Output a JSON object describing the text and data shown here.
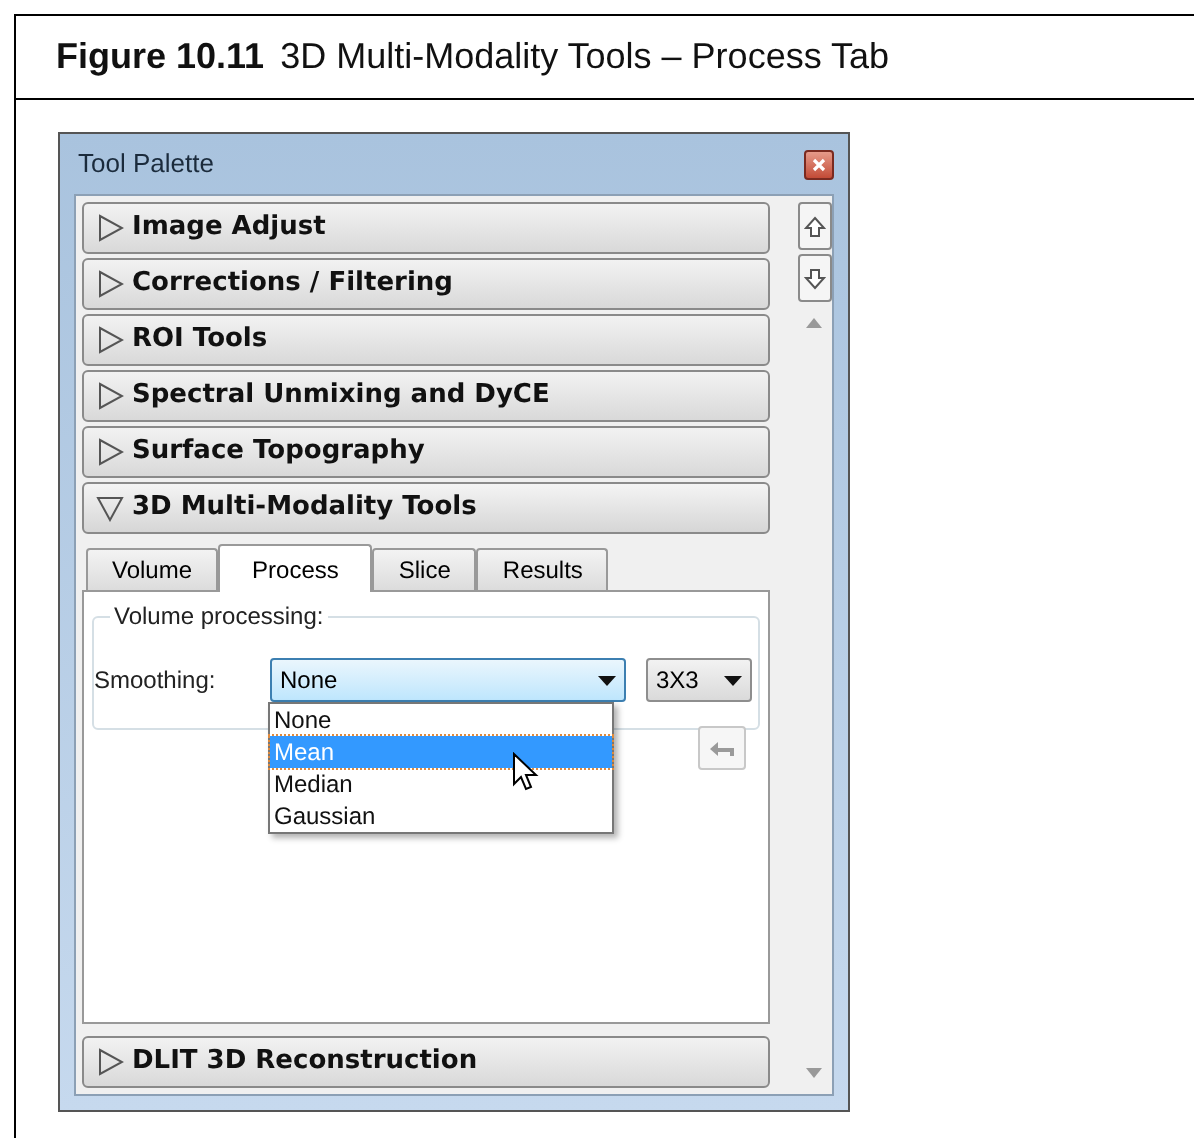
{
  "caption": {
    "number": "Figure 10.11",
    "title": "3D Multi-Modality Tools – Process Tab"
  },
  "window": {
    "title": "Tool Palette"
  },
  "sections": [
    {
      "label": "Image Adjust",
      "expanded": false
    },
    {
      "label": "Corrections / Filtering",
      "expanded": false
    },
    {
      "label": "ROI Tools",
      "expanded": false
    },
    {
      "label": "Spectral Unmixing and DyCE",
      "expanded": false
    },
    {
      "label": "Surface Topography",
      "expanded": false
    },
    {
      "label": "3D Multi-Modality Tools",
      "expanded": true
    },
    {
      "label": "DLIT 3D Reconstruction",
      "expanded": false
    }
  ],
  "tabs": [
    {
      "label": "Volume",
      "selected": false
    },
    {
      "label": "Process",
      "selected": true
    },
    {
      "label": "Slice",
      "selected": false
    },
    {
      "label": "Results",
      "selected": false
    }
  ],
  "group": {
    "title": "Volume processing:"
  },
  "smoothing": {
    "label": "Smoothing:",
    "value": "None",
    "options": [
      {
        "label": "None",
        "highlighted": false
      },
      {
        "label": "Mean",
        "highlighted": true
      },
      {
        "label": "Median",
        "highlighted": false
      },
      {
        "label": "Gaussian",
        "highlighted": false
      }
    ]
  },
  "kernel": {
    "value": "3X3"
  }
}
